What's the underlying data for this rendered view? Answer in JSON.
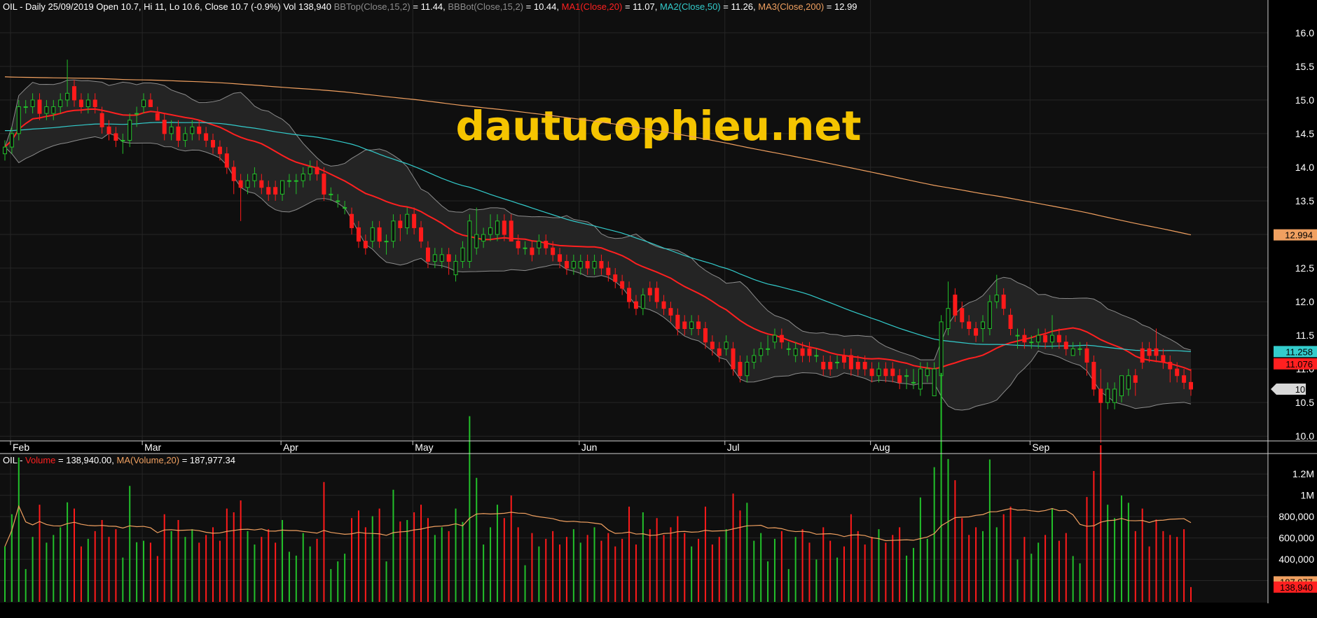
{
  "header": {
    "price_info": {
      "prefix": "OIL - Daily 25/09/2019 Open 10.7, Hi 11, Lo 10.6, Close 10.7 (-0.9%) Vol 138,940 ",
      "bbtop_label": "BBTop(Close,15,2)",
      "bbtop_value": " = 11.44, ",
      "bbbot_label": "BBBot(Close,15,2)",
      "bbbot_value": " = 10.44, ",
      "ma1_label": "MA1(Close,20)",
      "ma1_value": " = 11.07, ",
      "ma2_label": "MA2(Close,50)",
      "ma2_value": " = 11.26, ",
      "ma3_label": "MA3(Close,200)",
      "ma3_value": " = 12.99"
    },
    "volume_info": {
      "prefix": "OIL - ",
      "vol_label": "Volume",
      "vol_value": " = 138,940.00, ",
      "ma_label": "MA(Volume,20)",
      "ma_value": " = 187,977.34"
    }
  },
  "watermark": "dautucophieu.net",
  "colors": {
    "up": "#22c02a",
    "down": "#ff1a1a",
    "ma1": "#ff2020",
    "ma2": "#33cccc",
    "ma3": "#f0a060",
    "bb": "#8c8c8c",
    "watermark": "#f5c400",
    "axis_text": "#ffffff",
    "grid": "#262626"
  },
  "price_labels": {
    "ma3": "12.994",
    "ma2": "11.258",
    "ma1": "11.076",
    "close": "10.7"
  },
  "volume_labels": {
    "ma": "187,977",
    "vol": "138,940"
  },
  "chart_data": [
    {
      "type": "candlestick",
      "title": "OIL - Daily",
      "x_ticks": [
        "Feb",
        "Mar",
        "Apr",
        "May",
        "Jun",
        "Jul",
        "Aug",
        "Sep"
      ],
      "x_tick_days": [
        0,
        19,
        39,
        58,
        82,
        103,
        124,
        147
      ],
      "y_ticks": [
        "16.0",
        "15.5",
        "15.0",
        "14.5",
        "14.0",
        "13.5",
        "13.0",
        "12.5",
        "12.0",
        "11.5",
        "11.0",
        "10.5",
        "10.0"
      ],
      "ylim": [
        9.95,
        16.3
      ],
      "grid": true,
      "ohlc": [
        [
          14.2,
          14.4,
          14.1,
          14.3
        ],
        [
          14.3,
          14.6,
          14.2,
          14.5
        ],
        [
          14.5,
          15.0,
          14.4,
          14.9
        ],
        [
          14.9,
          15.0,
          14.8,
          14.9
        ],
        [
          14.9,
          15.1,
          14.8,
          15.0
        ],
        [
          15.0,
          15.1,
          14.7,
          14.8
        ],
        [
          14.8,
          15.0,
          14.7,
          14.9
        ],
        [
          14.8,
          15.0,
          14.7,
          14.9
        ],
        [
          14.9,
          15.1,
          14.8,
          15.0
        ],
        [
          15.0,
          15.6,
          14.9,
          15.1
        ],
        [
          15.2,
          15.3,
          14.9,
          15.0
        ],
        [
          15.0,
          15.1,
          14.8,
          14.9
        ],
        [
          14.9,
          15.1,
          14.8,
          15.0
        ],
        [
          15.0,
          15.1,
          14.8,
          14.9
        ],
        [
          14.8,
          14.9,
          14.5,
          14.6
        ],
        [
          14.6,
          14.7,
          14.4,
          14.5
        ],
        [
          14.5,
          14.6,
          14.3,
          14.4
        ],
        [
          14.4,
          14.5,
          14.2,
          14.4
        ],
        [
          14.4,
          14.8,
          14.3,
          14.7
        ],
        [
          14.8,
          14.9,
          14.6,
          14.8
        ],
        [
          14.9,
          15.1,
          14.8,
          15.0
        ],
        [
          15.0,
          15.1,
          14.9,
          14.9
        ],
        [
          14.8,
          14.9,
          14.7,
          14.7
        ],
        [
          14.7,
          14.8,
          14.4,
          14.5
        ],
        [
          14.5,
          14.7,
          14.4,
          14.6
        ],
        [
          14.6,
          14.7,
          14.3,
          14.4
        ],
        [
          14.4,
          14.6,
          14.3,
          14.5
        ],
        [
          14.5,
          14.7,
          14.4,
          14.6
        ],
        [
          14.6,
          14.7,
          14.4,
          14.5
        ],
        [
          14.5,
          14.6,
          14.3,
          14.4
        ],
        [
          14.4,
          14.5,
          14.2,
          14.3
        ],
        [
          14.3,
          14.4,
          14.1,
          14.2
        ],
        [
          14.2,
          14.3,
          13.9,
          14.0
        ],
        [
          14.0,
          14.1,
          13.6,
          13.8
        ],
        [
          13.8,
          13.9,
          13.2,
          13.7
        ],
        [
          13.7,
          13.9,
          13.6,
          13.8
        ],
        [
          13.8,
          14.0,
          13.7,
          13.9
        ],
        [
          13.8,
          13.9,
          13.6,
          13.7
        ],
        [
          13.7,
          13.8,
          13.5,
          13.6
        ],
        [
          13.7,
          13.8,
          13.5,
          13.6
        ],
        [
          13.6,
          13.8,
          13.5,
          13.8
        ],
        [
          13.8,
          13.9,
          13.7,
          13.8
        ],
        [
          13.8,
          13.9,
          13.6,
          13.8
        ],
        [
          13.8,
          14.0,
          13.7,
          13.9
        ],
        [
          13.9,
          14.1,
          13.8,
          14.0
        ],
        [
          14.0,
          14.1,
          13.8,
          13.9
        ],
        [
          13.9,
          14.0,
          13.5,
          13.6
        ],
        [
          13.6,
          13.7,
          13.5,
          13.6
        ],
        [
          13.5,
          13.6,
          13.4,
          13.5
        ],
        [
          13.4,
          13.5,
          13.3,
          13.4
        ],
        [
          13.3,
          13.4,
          13.0,
          13.1
        ],
        [
          13.1,
          13.2,
          12.8,
          12.9
        ],
        [
          12.9,
          13.0,
          12.7,
          12.8
        ],
        [
          12.9,
          13.2,
          12.8,
          13.1
        ],
        [
          13.1,
          13.2,
          12.8,
          12.9
        ],
        [
          12.9,
          13.0,
          12.7,
          12.9
        ],
        [
          12.9,
          13.3,
          12.8,
          13.2
        ],
        [
          13.2,
          13.3,
          12.9,
          13.1
        ],
        [
          13.1,
          13.4,
          13.0,
          13.3
        ],
        [
          13.3,
          13.4,
          13.0,
          13.1
        ],
        [
          13.1,
          13.2,
          12.8,
          12.9
        ],
        [
          12.8,
          12.9,
          12.5,
          12.6
        ],
        [
          12.6,
          12.8,
          12.5,
          12.7
        ],
        [
          12.6,
          12.8,
          12.5,
          12.7
        ],
        [
          12.7,
          12.8,
          12.4,
          12.6
        ],
        [
          12.4,
          12.7,
          12.3,
          12.6
        ],
        [
          12.6,
          12.9,
          12.5,
          12.8
        ],
        [
          12.6,
          13.3,
          12.5,
          13.2
        ],
        [
          12.8,
          13.4,
          12.7,
          13.0
        ],
        [
          12.9,
          13.1,
          12.8,
          13.0
        ],
        [
          13.0,
          13.3,
          12.9,
          13.1
        ],
        [
          13.0,
          13.3,
          12.9,
          13.2
        ],
        [
          13.2,
          13.3,
          12.9,
          13.0
        ],
        [
          13.2,
          13.3,
          12.9,
          12.9
        ],
        [
          12.9,
          13.0,
          12.7,
          12.8
        ],
        [
          12.8,
          12.9,
          12.7,
          12.8
        ],
        [
          12.8,
          12.9,
          12.6,
          12.7
        ],
        [
          12.8,
          13.0,
          12.7,
          12.9
        ],
        [
          12.9,
          13.0,
          12.7,
          12.8
        ],
        [
          12.8,
          12.9,
          12.6,
          12.7
        ],
        [
          12.7,
          12.8,
          12.5,
          12.6
        ],
        [
          12.6,
          12.7,
          12.4,
          12.5
        ],
        [
          12.5,
          12.7,
          12.4,
          12.6
        ],
        [
          12.5,
          12.7,
          12.4,
          12.6
        ],
        [
          12.6,
          12.7,
          12.4,
          12.5
        ],
        [
          12.5,
          12.7,
          12.4,
          12.6
        ],
        [
          12.6,
          12.7,
          12.4,
          12.5
        ],
        [
          12.5,
          12.6,
          12.3,
          12.4
        ],
        [
          12.4,
          12.5,
          12.2,
          12.3
        ],
        [
          12.3,
          12.4,
          12.1,
          12.2
        ],
        [
          12.2,
          12.3,
          11.9,
          12.0
        ],
        [
          12.0,
          12.1,
          11.8,
          11.9
        ],
        [
          11.9,
          12.2,
          11.8,
          12.1
        ],
        [
          12.2,
          12.3,
          12.0,
          12.1
        ],
        [
          12.2,
          12.3,
          11.9,
          12.0
        ],
        [
          12.0,
          12.1,
          11.8,
          11.9
        ],
        [
          11.9,
          12.0,
          11.7,
          11.8
        ],
        [
          11.8,
          11.9,
          11.5,
          11.6
        ],
        [
          11.7,
          11.8,
          11.5,
          11.6
        ],
        [
          11.6,
          11.8,
          11.5,
          11.7
        ],
        [
          11.7,
          11.8,
          11.5,
          11.6
        ],
        [
          11.6,
          11.7,
          11.3,
          11.4
        ],
        [
          11.4,
          11.5,
          11.2,
          11.3
        ],
        [
          11.3,
          11.4,
          11.1,
          11.2
        ],
        [
          11.3,
          11.5,
          11.2,
          11.4
        ],
        [
          11.3,
          11.4,
          10.9,
          11.0
        ],
        [
          11.1,
          11.2,
          10.8,
          10.9
        ],
        [
          10.9,
          11.2,
          10.8,
          11.1
        ],
        [
          11.1,
          11.3,
          11.0,
          11.2
        ],
        [
          11.2,
          11.4,
          11.1,
          11.3
        ],
        [
          11.3,
          11.5,
          11.2,
          11.3
        ],
        [
          11.4,
          11.6,
          11.3,
          11.5
        ],
        [
          11.5,
          11.6,
          11.3,
          11.4
        ],
        [
          11.3,
          11.4,
          11.2,
          11.3
        ],
        [
          11.2,
          11.4,
          11.1,
          11.3
        ],
        [
          11.3,
          11.4,
          11.1,
          11.2
        ],
        [
          11.3,
          11.4,
          11.1,
          11.2
        ],
        [
          11.2,
          11.3,
          11.1,
          11.2
        ],
        [
          11.1,
          11.2,
          10.9,
          11.0
        ],
        [
          11.1,
          11.2,
          10.9,
          11.0
        ],
        [
          11.1,
          11.2,
          11.0,
          11.1
        ],
        [
          11.2,
          11.3,
          11.0,
          11.1
        ],
        [
          11.2,
          11.3,
          10.9,
          11.0
        ],
        [
          11.1,
          11.2,
          10.9,
          11.0
        ],
        [
          11.1,
          11.2,
          10.9,
          11.0
        ],
        [
          11.0,
          11.1,
          10.8,
          10.9
        ],
        [
          10.9,
          11.1,
          10.8,
          11.0
        ],
        [
          11.0,
          11.1,
          10.8,
          10.9
        ],
        [
          11.0,
          11.1,
          10.8,
          10.9
        ],
        [
          10.9,
          11.0,
          10.7,
          10.8
        ],
        [
          10.9,
          11.0,
          10.7,
          10.9
        ],
        [
          10.8,
          11.0,
          10.7,
          10.8
        ],
        [
          10.7,
          11.1,
          10.6,
          11.0
        ],
        [
          10.9,
          11.1,
          10.8,
          11.0
        ],
        [
          10.6,
          11.1,
          10.6,
          11.0
        ],
        [
          10.9,
          11.8,
          10.8,
          11.7
        ],
        [
          11.6,
          12.3,
          11.5,
          11.9
        ],
        [
          12.1,
          12.2,
          11.7,
          11.8
        ],
        [
          11.9,
          12.0,
          11.6,
          11.7
        ],
        [
          11.7,
          11.8,
          11.5,
          11.6
        ],
        [
          11.6,
          11.7,
          11.4,
          11.5
        ],
        [
          11.6,
          11.8,
          11.4,
          11.7
        ],
        [
          11.6,
          12.1,
          11.5,
          12.0
        ],
        [
          12.0,
          12.4,
          11.9,
          12.1
        ],
        [
          12.1,
          12.2,
          11.8,
          11.9
        ],
        [
          11.8,
          11.9,
          11.5,
          11.6
        ],
        [
          11.5,
          11.6,
          11.3,
          11.5
        ],
        [
          11.5,
          11.6,
          11.3,
          11.4
        ],
        [
          11.4,
          11.5,
          11.3,
          11.4
        ],
        [
          11.4,
          11.6,
          11.3,
          11.5
        ],
        [
          11.5,
          11.6,
          11.3,
          11.4
        ],
        [
          11.4,
          11.8,
          11.3,
          11.5
        ],
        [
          11.5,
          11.6,
          11.3,
          11.4
        ],
        [
          11.4,
          11.5,
          11.2,
          11.3
        ],
        [
          11.2,
          11.4,
          11.2,
          11.3
        ],
        [
          11.3,
          11.4,
          11.2,
          11.3
        ],
        [
          11.3,
          11.4,
          10.9,
          11.1
        ],
        [
          11.1,
          11.2,
          10.6,
          10.7
        ],
        [
          10.7,
          11.0,
          9.9,
          10.5
        ],
        [
          10.5,
          10.8,
          10.4,
          10.7
        ],
        [
          10.5,
          10.8,
          10.4,
          10.7
        ],
        [
          10.6,
          10.9,
          10.5,
          10.9
        ],
        [
          10.7,
          11.0,
          10.6,
          10.9
        ],
        [
          10.9,
          11.0,
          10.6,
          10.8
        ],
        [
          11.3,
          11.4,
          11.0,
          11.1
        ],
        [
          11.3,
          11.4,
          11.1,
          11.2
        ],
        [
          11.3,
          11.6,
          11.1,
          11.2
        ],
        [
          11.2,
          11.3,
          11.0,
          11.1
        ],
        [
          11.1,
          11.2,
          10.8,
          11.0
        ],
        [
          11.0,
          11.1,
          10.8,
          10.9
        ],
        [
          10.9,
          11.0,
          10.7,
          10.8
        ],
        [
          10.8,
          11.0,
          10.6,
          10.7
        ]
      ]
    },
    {
      "type": "bar",
      "title": "OIL - Volume",
      "y_ticks": [
        "1.2M",
        "1M",
        "800,000",
        "600,000",
        "400,000",
        "200,000"
      ],
      "ylim": [
        0,
        1300000
      ],
      "ma_period": 20
    }
  ]
}
